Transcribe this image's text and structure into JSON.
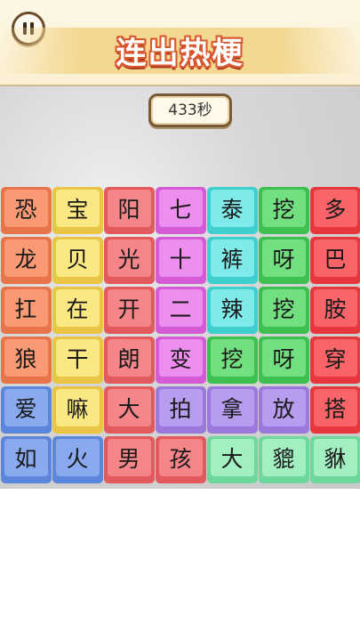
{
  "header": {
    "title": "连出热梗",
    "pause_icon": "pause-icon"
  },
  "timer": {
    "label": "433秒"
  },
  "board": {
    "colors": {
      "orange": "#fa9a74",
      "yellow": "#fbe882",
      "red": "#f58589",
      "magenta": "#ee8ff0",
      "teal": "#7eeaea",
      "green": "#72e080",
      "crimson": "#f86468",
      "blue": "#8aaaf0",
      "violet": "#b89cf0",
      "mint": "#a2f0c2"
    },
    "rows": [
      [
        {
          "ch": "恐",
          "c": "orange"
        },
        {
          "ch": "宝",
          "c": "yellow"
        },
        {
          "ch": "阳",
          "c": "red"
        },
        {
          "ch": "七",
          "c": "magenta"
        },
        {
          "ch": "泰",
          "c": "teal"
        },
        {
          "ch": "挖",
          "c": "green"
        },
        {
          "ch": "多",
          "c": "crimson"
        }
      ],
      [
        {
          "ch": "龙",
          "c": "orange"
        },
        {
          "ch": "贝",
          "c": "yellow"
        },
        {
          "ch": "光",
          "c": "red"
        },
        {
          "ch": "十",
          "c": "magenta"
        },
        {
          "ch": "裤",
          "c": "teal"
        },
        {
          "ch": "呀",
          "c": "green"
        },
        {
          "ch": "巴",
          "c": "crimson"
        }
      ],
      [
        {
          "ch": "扛",
          "c": "orange"
        },
        {
          "ch": "在",
          "c": "yellow"
        },
        {
          "ch": "开",
          "c": "red"
        },
        {
          "ch": "二",
          "c": "magenta"
        },
        {
          "ch": "辣",
          "c": "teal"
        },
        {
          "ch": "挖",
          "c": "green"
        },
        {
          "ch": "胺",
          "c": "crimson"
        }
      ],
      [
        {
          "ch": "狼",
          "c": "orange"
        },
        {
          "ch": "干",
          "c": "yellow"
        },
        {
          "ch": "朗",
          "c": "red"
        },
        {
          "ch": "变",
          "c": "magenta"
        },
        {
          "ch": "挖",
          "c": "green"
        },
        {
          "ch": "呀",
          "c": "green"
        },
        {
          "ch": "穿",
          "c": "crimson"
        }
      ],
      [
        {
          "ch": "爱",
          "c": "blue"
        },
        {
          "ch": "嘛",
          "c": "yellow"
        },
        {
          "ch": "大",
          "c": "red"
        },
        {
          "ch": "拍",
          "c": "violet"
        },
        {
          "ch": "拿",
          "c": "violet"
        },
        {
          "ch": "放",
          "c": "violet"
        },
        {
          "ch": "搭",
          "c": "crimson"
        }
      ],
      [
        {
          "ch": "如",
          "c": "blue"
        },
        {
          "ch": "火",
          "c": "blue"
        },
        {
          "ch": "男",
          "c": "red"
        },
        {
          "ch": "孩",
          "c": "red"
        },
        {
          "ch": "大",
          "c": "mint"
        },
        {
          "ch": "貔",
          "c": "mint"
        },
        {
          "ch": "貅",
          "c": "mint"
        }
      ]
    ]
  }
}
